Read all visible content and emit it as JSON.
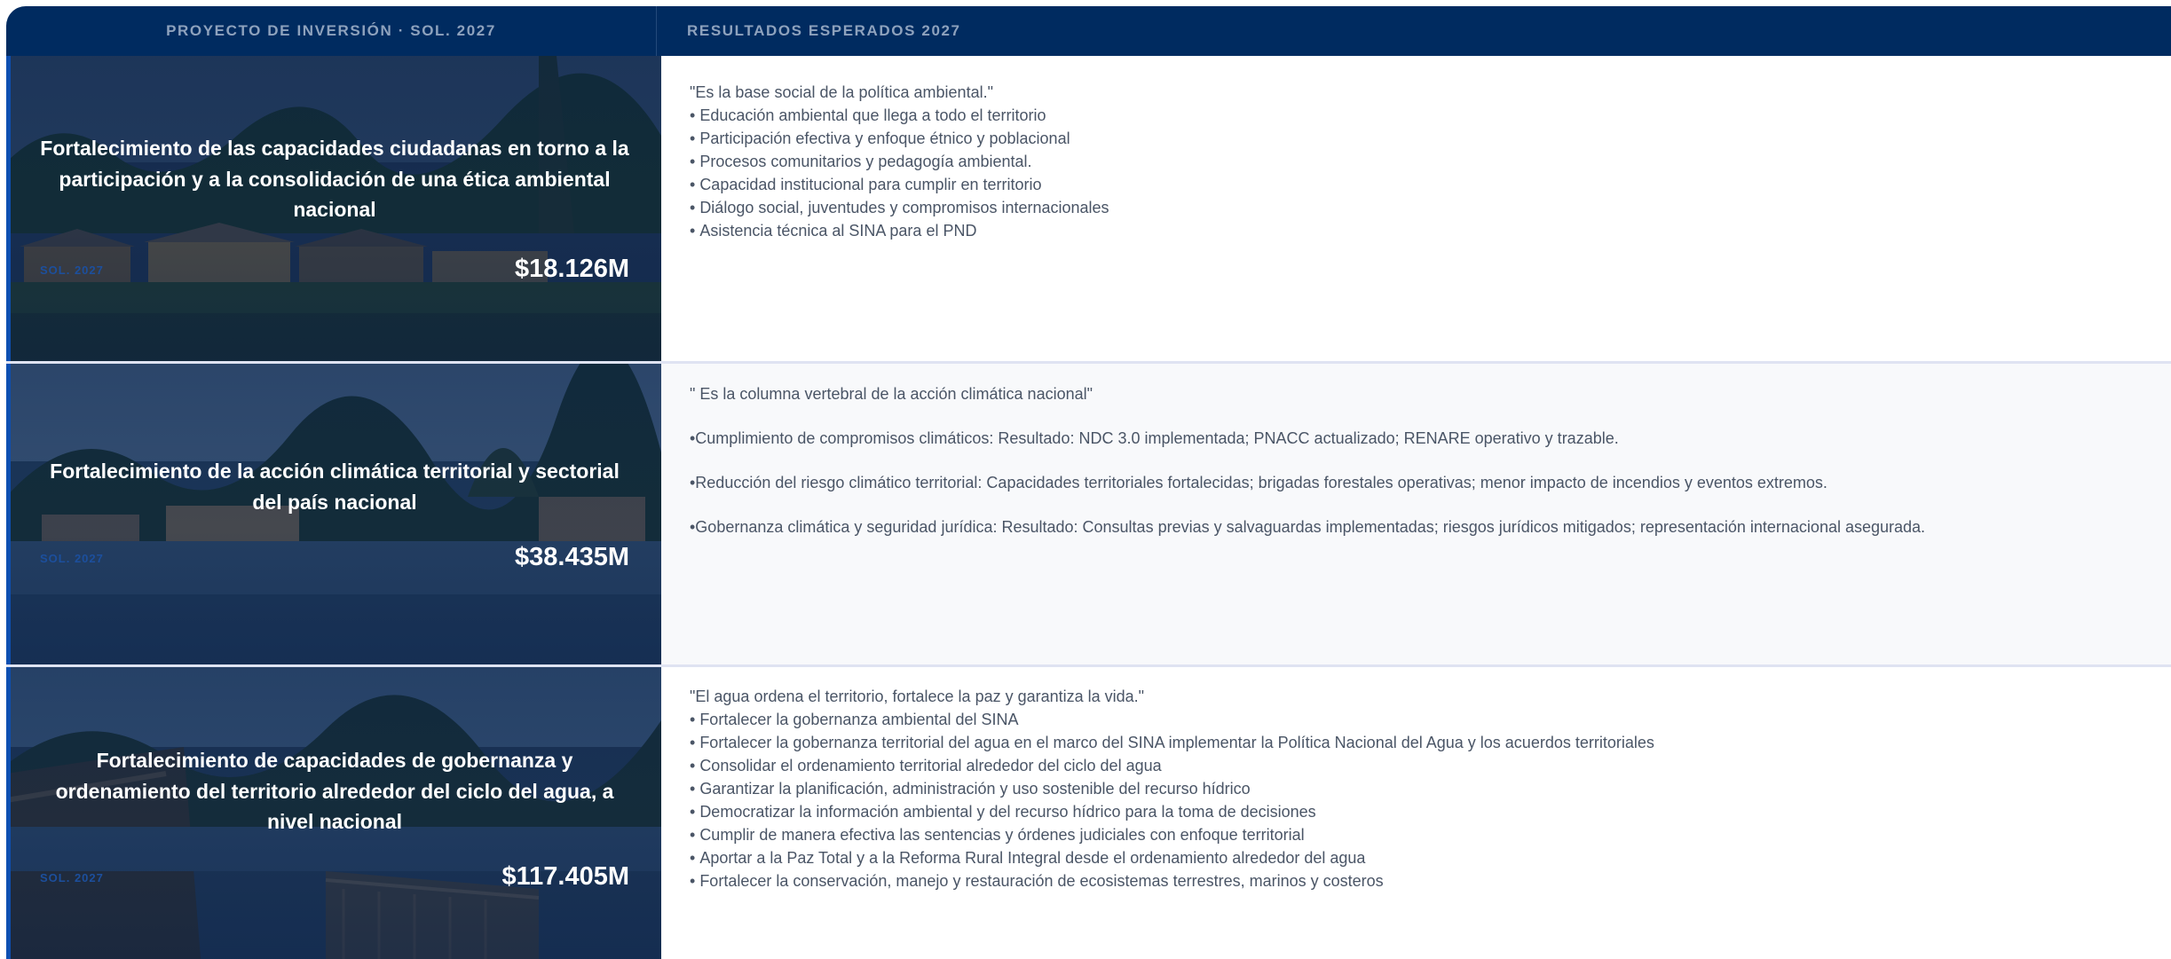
{
  "header": {
    "col1": "PROYECTO DE INVERSIÓN · SOL. 2027",
    "col2": "RESULTADOS ESPERADOS 2027"
  },
  "colors": {
    "header_bg": "#002b60",
    "accent": "#0d4fb1",
    "text": "#4a5566"
  },
  "projects": [
    {
      "title": "Fortalecimiento de las capacidades ciudadanas en torno a la participación y a la consolidación de una ética ambiental nacional",
      "sol": "SOL. 2027",
      "amount": "$18.126M",
      "quote": "\"Es la base social de la política ambiental.\"",
      "bullets": [
        "Educación ambiental que llega a todo el territorio",
        "Participación efectiva y enfoque étnico y poblacional",
        "Procesos comunitarios y pedagogía ambiental.",
        "Capacidad institucional para cumplir en territorio",
        "Diálogo social, juventudes y compromisos internacionales",
        "Asistencia técnica al SINA para el PND"
      ]
    },
    {
      "title": "Fortalecimiento de la acción climática territorial y sectorial del país nacional",
      "sol": "SOL. 2027",
      "amount": "$38.435M",
      "quote": "\" Es la columna vertebral de la acción climática nacional\"",
      "paragraphs": [
        "•Cumplimiento de compromisos climáticos: Resultado: NDC 3.0 implementada; PNACC actualizado; RENARE operativo y trazable.",
        "•Reducción del riesgo climático territorial: Capacidades territoriales fortalecidas; brigadas forestales operativas; menor impacto de incendios y eventos extremos.",
        "•Gobernanza climática y seguridad jurídica: Resultado: Consultas previas y salvaguardas implementadas; riesgos jurídicos mitigados; representación internacional asegurada."
      ]
    },
    {
      "title": "Fortalecimiento de capacidades de gobernanza y ordenamiento del territorio alrededor del ciclo del agua, a nivel nacional",
      "sol": "SOL. 2027",
      "amount": "$117.405M",
      "quote": "\"El agua ordena el territorio, fortalece la paz y garantiza la vida.\"",
      "bullets": [
        "Fortalecer la gobernanza ambiental del SINA",
        "Fortalecer la gobernanza territorial del agua en el marco del SINA implementar la Política Nacional del Agua y los acuerdos territoriales",
        "Consolidar el ordenamiento territorial alrededor del ciclo del agua",
        "Garantizar la planificación, administración y uso sostenible del recurso hídrico",
        "Democratizar la información ambiental y del recurso hídrico para la toma de decisiones",
        "Cumplir de manera efectiva las sentencias y órdenes judiciales con enfoque territorial",
        "Aportar a la Paz Total y a la Reforma Rural Integral desde el ordenamiento alrededor del agua",
        "Fortalecer la conservación, manejo y restauración de ecosistemas terrestres, marinos y costeros"
      ]
    }
  ]
}
